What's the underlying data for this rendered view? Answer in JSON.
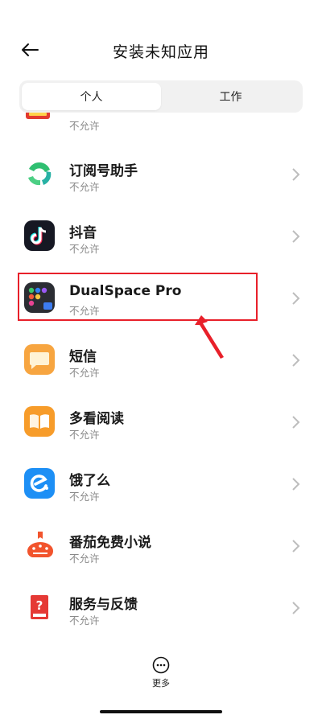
{
  "header": {
    "title": "安装未知应用"
  },
  "tabs": [
    {
      "label": "个人",
      "active": true
    },
    {
      "label": "工作",
      "active": false
    }
  ],
  "apps": [
    {
      "name": "",
      "status": "不允许",
      "icon": "red-badge-app-icon"
    },
    {
      "name": "订阅号助手",
      "status": "不允许",
      "icon": "subscription-assistant-icon"
    },
    {
      "name": "抖音",
      "status": "不允许",
      "icon": "douyin-icon"
    },
    {
      "name": "DualSpace Pro",
      "status": "不允许",
      "icon": "dualspace-pro-icon"
    },
    {
      "name": "短信",
      "status": "不允许",
      "icon": "sms-icon"
    },
    {
      "name": "多看阅读",
      "status": "不允许",
      "icon": "duokan-reader-icon"
    },
    {
      "name": "饿了么",
      "status": "不允许",
      "icon": "eleme-icon"
    },
    {
      "name": "番茄免费小说",
      "status": "不允许",
      "icon": "fanqie-novel-icon"
    },
    {
      "name": "服务与反馈",
      "status": "不允许",
      "icon": "service-feedback-icon"
    }
  ],
  "footer": {
    "more_label": "更多"
  },
  "colors": {
    "highlight": "#e8202a",
    "accent_green": "#27c47a",
    "douyin_bg": "#161823",
    "sms_orange": "#f7a540",
    "eleme_blue": "#1d8ff5",
    "fanqie_red": "#f2542d"
  }
}
